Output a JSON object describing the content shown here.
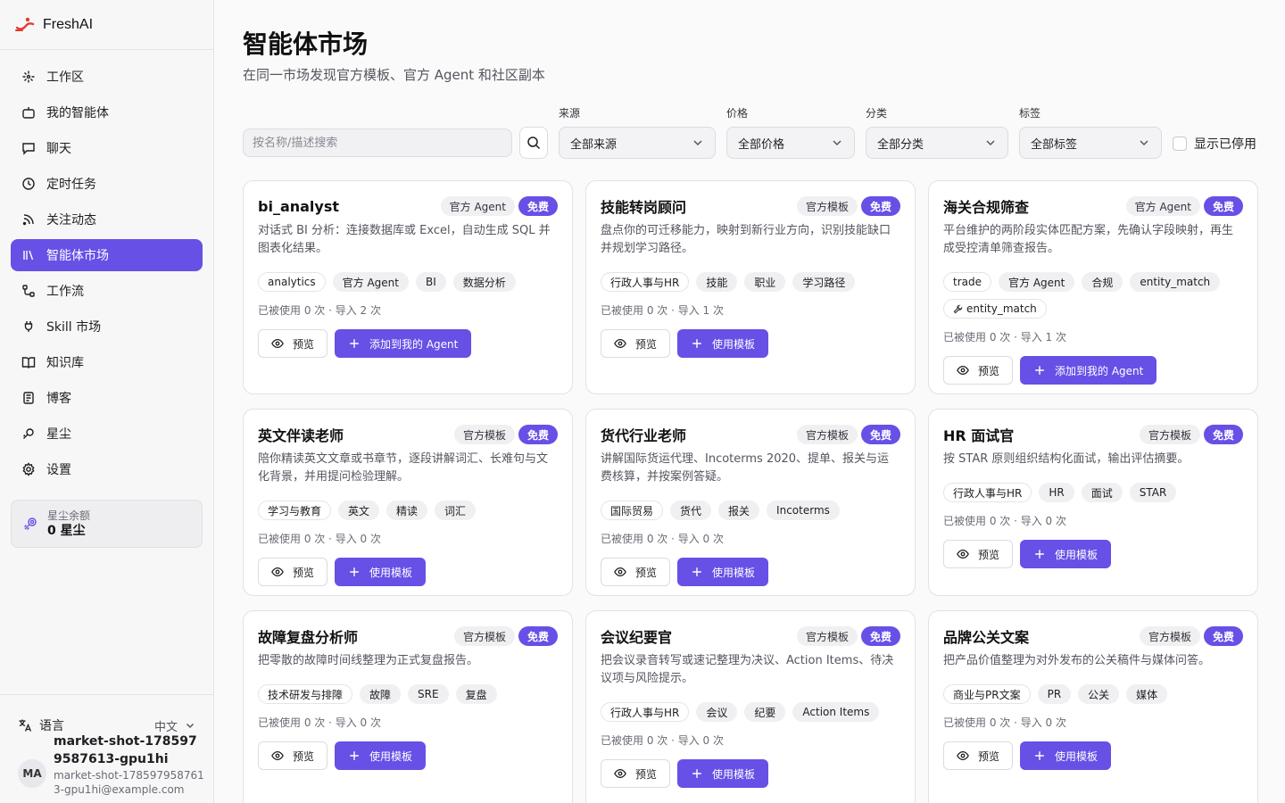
{
  "brand": {
    "name": "FreshAI",
    "accent": "#e23b2e"
  },
  "sidebar": {
    "items": [
      {
        "label": "工作区",
        "icon": "workspace-icon"
      },
      {
        "label": "我的智能体",
        "icon": "robot-icon"
      },
      {
        "label": "聊天",
        "icon": "chat-icon"
      },
      {
        "label": "定时任务",
        "icon": "clock-icon"
      },
      {
        "label": "关注动态",
        "icon": "rss-icon"
      },
      {
        "label": "智能体市场",
        "icon": "library-icon",
        "active": true
      },
      {
        "label": "工作流",
        "icon": "workflow-icon"
      },
      {
        "label": "Skill 市场",
        "icon": "plug-icon"
      },
      {
        "label": "知识库",
        "icon": "book-icon"
      },
      {
        "label": "博客",
        "icon": "blog-icon"
      },
      {
        "label": "星尘",
        "icon": "stardust-icon"
      },
      {
        "label": "设置",
        "icon": "gear-icon"
      }
    ],
    "credits": {
      "label": "星尘余额",
      "value": "0 星尘"
    },
    "footer": {
      "language_label": "语言",
      "language_value": "中文",
      "avatar_initials": "MA",
      "user_name": "market-shot-1785979587613-gpu1hi",
      "user_email": "market-shot-1785979587613-gpu1hi@example.com"
    }
  },
  "page": {
    "title": "智能体市场",
    "subtitle": "在同一市场发现官方模板、官方 Agent 和社区副本"
  },
  "filters": {
    "search_placeholder": "按名称/描述搜索",
    "source": {
      "label": "来源",
      "value": "全部来源"
    },
    "price": {
      "label": "价格",
      "value": "全部价格"
    },
    "category": {
      "label": "分类",
      "value": "全部分类"
    },
    "tags": {
      "label": "标签",
      "value": "全部标签"
    },
    "show_disabled_label": "显示已停用"
  },
  "cards": [
    {
      "title": "bi_analyst",
      "source_badge": "官方 Agent",
      "price_badge": "免费",
      "description": "对话式 BI 分析：连接数据库或 Excel，自动生成 SQL 并图表化结果。",
      "tags": [
        "analytics",
        "官方 Agent",
        "BI",
        "数据分析"
      ],
      "stats": "已被使用 0 次 · 导入 2 次",
      "preview_label": "预览",
      "primary_label": "添加到我的 Agent"
    },
    {
      "title": "技能转岗顾问",
      "source_badge": "官方模板",
      "price_badge": "免费",
      "description": "盘点你的可迁移能力，映射到新行业方向，识别技能缺口并规划学习路径。",
      "tags": [
        "行政人事与HR",
        "技能",
        "职业",
        "学习路径"
      ],
      "stats": "已被使用 0 次 · 导入 1 次",
      "preview_label": "预览",
      "primary_label": "使用模板"
    },
    {
      "title": "海关合规筛查",
      "source_badge": "官方 Agent",
      "price_badge": "免费",
      "description": "平台维护的两阶段实体匹配方案，先确认字段映射，再生成受控清单筛查报告。",
      "tags": [
        "trade",
        "官方 Agent",
        "合规",
        "entity_match"
      ],
      "skill_tag": "entity_match",
      "stats": "已被使用 0 次 · 导入 1 次",
      "preview_label": "预览",
      "primary_label": "添加到我的 Agent"
    },
    {
      "title": "英文伴读老师",
      "source_badge": "官方模板",
      "price_badge": "免费",
      "description": "陪你精读英文文章或书章节，逐段讲解词汇、长难句与文化背景，并用提问检验理解。",
      "tags": [
        "学习与教育",
        "英文",
        "精读",
        "词汇"
      ],
      "stats": "已被使用 0 次 · 导入 0 次",
      "preview_label": "预览",
      "primary_label": "使用模板"
    },
    {
      "title": "货代行业老师",
      "source_badge": "官方模板",
      "price_badge": "免费",
      "description": "讲解国际货运代理、Incoterms 2020、提单、报关与运费核算，并按案例答疑。",
      "tags": [
        "国际贸易",
        "货代",
        "报关",
        "Incoterms"
      ],
      "stats": "已被使用 0 次 · 导入 0 次",
      "preview_label": "预览",
      "primary_label": "使用模板"
    },
    {
      "title": "HR 面试官",
      "source_badge": "官方模板",
      "price_badge": "免费",
      "description": "按 STAR 原则组织结构化面试，输出评估摘要。",
      "tags": [
        "行政人事与HR",
        "HR",
        "面试",
        "STAR"
      ],
      "stats": "已被使用 0 次 · 导入 0 次",
      "preview_label": "预览",
      "primary_label": "使用模板"
    },
    {
      "title": "故障复盘分析师",
      "source_badge": "官方模板",
      "price_badge": "免费",
      "description": "把零散的故障时间线整理为正式复盘报告。",
      "tags": [
        "技术研发与排障",
        "故障",
        "SRE",
        "复盘"
      ],
      "stats": "已被使用 0 次 · 导入 0 次",
      "preview_label": "预览",
      "primary_label": "使用模板"
    },
    {
      "title": "会议纪要官",
      "source_badge": "官方模板",
      "price_badge": "免费",
      "description": "把会议录音转写或速记整理为决议、Action Items、待决议项与风险提示。",
      "tags": [
        "行政人事与HR",
        "会议",
        "纪要",
        "Action Items"
      ],
      "stats": "已被使用 0 次 · 导入 0 次",
      "preview_label": "预览",
      "primary_label": "使用模板"
    },
    {
      "title": "品牌公关文案",
      "source_badge": "官方模板",
      "price_badge": "免费",
      "description": "把产品价值整理为对外发布的公关稿件与媒体问答。",
      "tags": [
        "商业与PR文案",
        "PR",
        "公关",
        "媒体"
      ],
      "stats": "已被使用 0 次 · 导入 0 次",
      "preview_label": "预览",
      "primary_label": "使用模板"
    }
  ]
}
